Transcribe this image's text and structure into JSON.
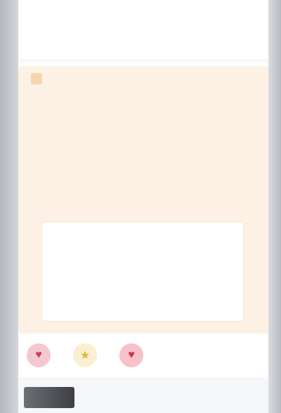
{
  "header": {
    "lines": [
      "",
      "",
      ""
    ]
  },
  "card": {
    "tag": "",
    "paragraphs": [
      "",
      "",
      "",
      "",
      "",
      "",
      "",
      "",
      "",
      ""
    ],
    "inner_box": {
      "lines": [
        "",
        "",
        "",
        ""
      ]
    }
  },
  "reactions": {
    "icons": [
      "heart-icon",
      "star-icon",
      "heart-icon"
    ],
    "count": ""
  },
  "bottom": {
    "label": ""
  }
}
